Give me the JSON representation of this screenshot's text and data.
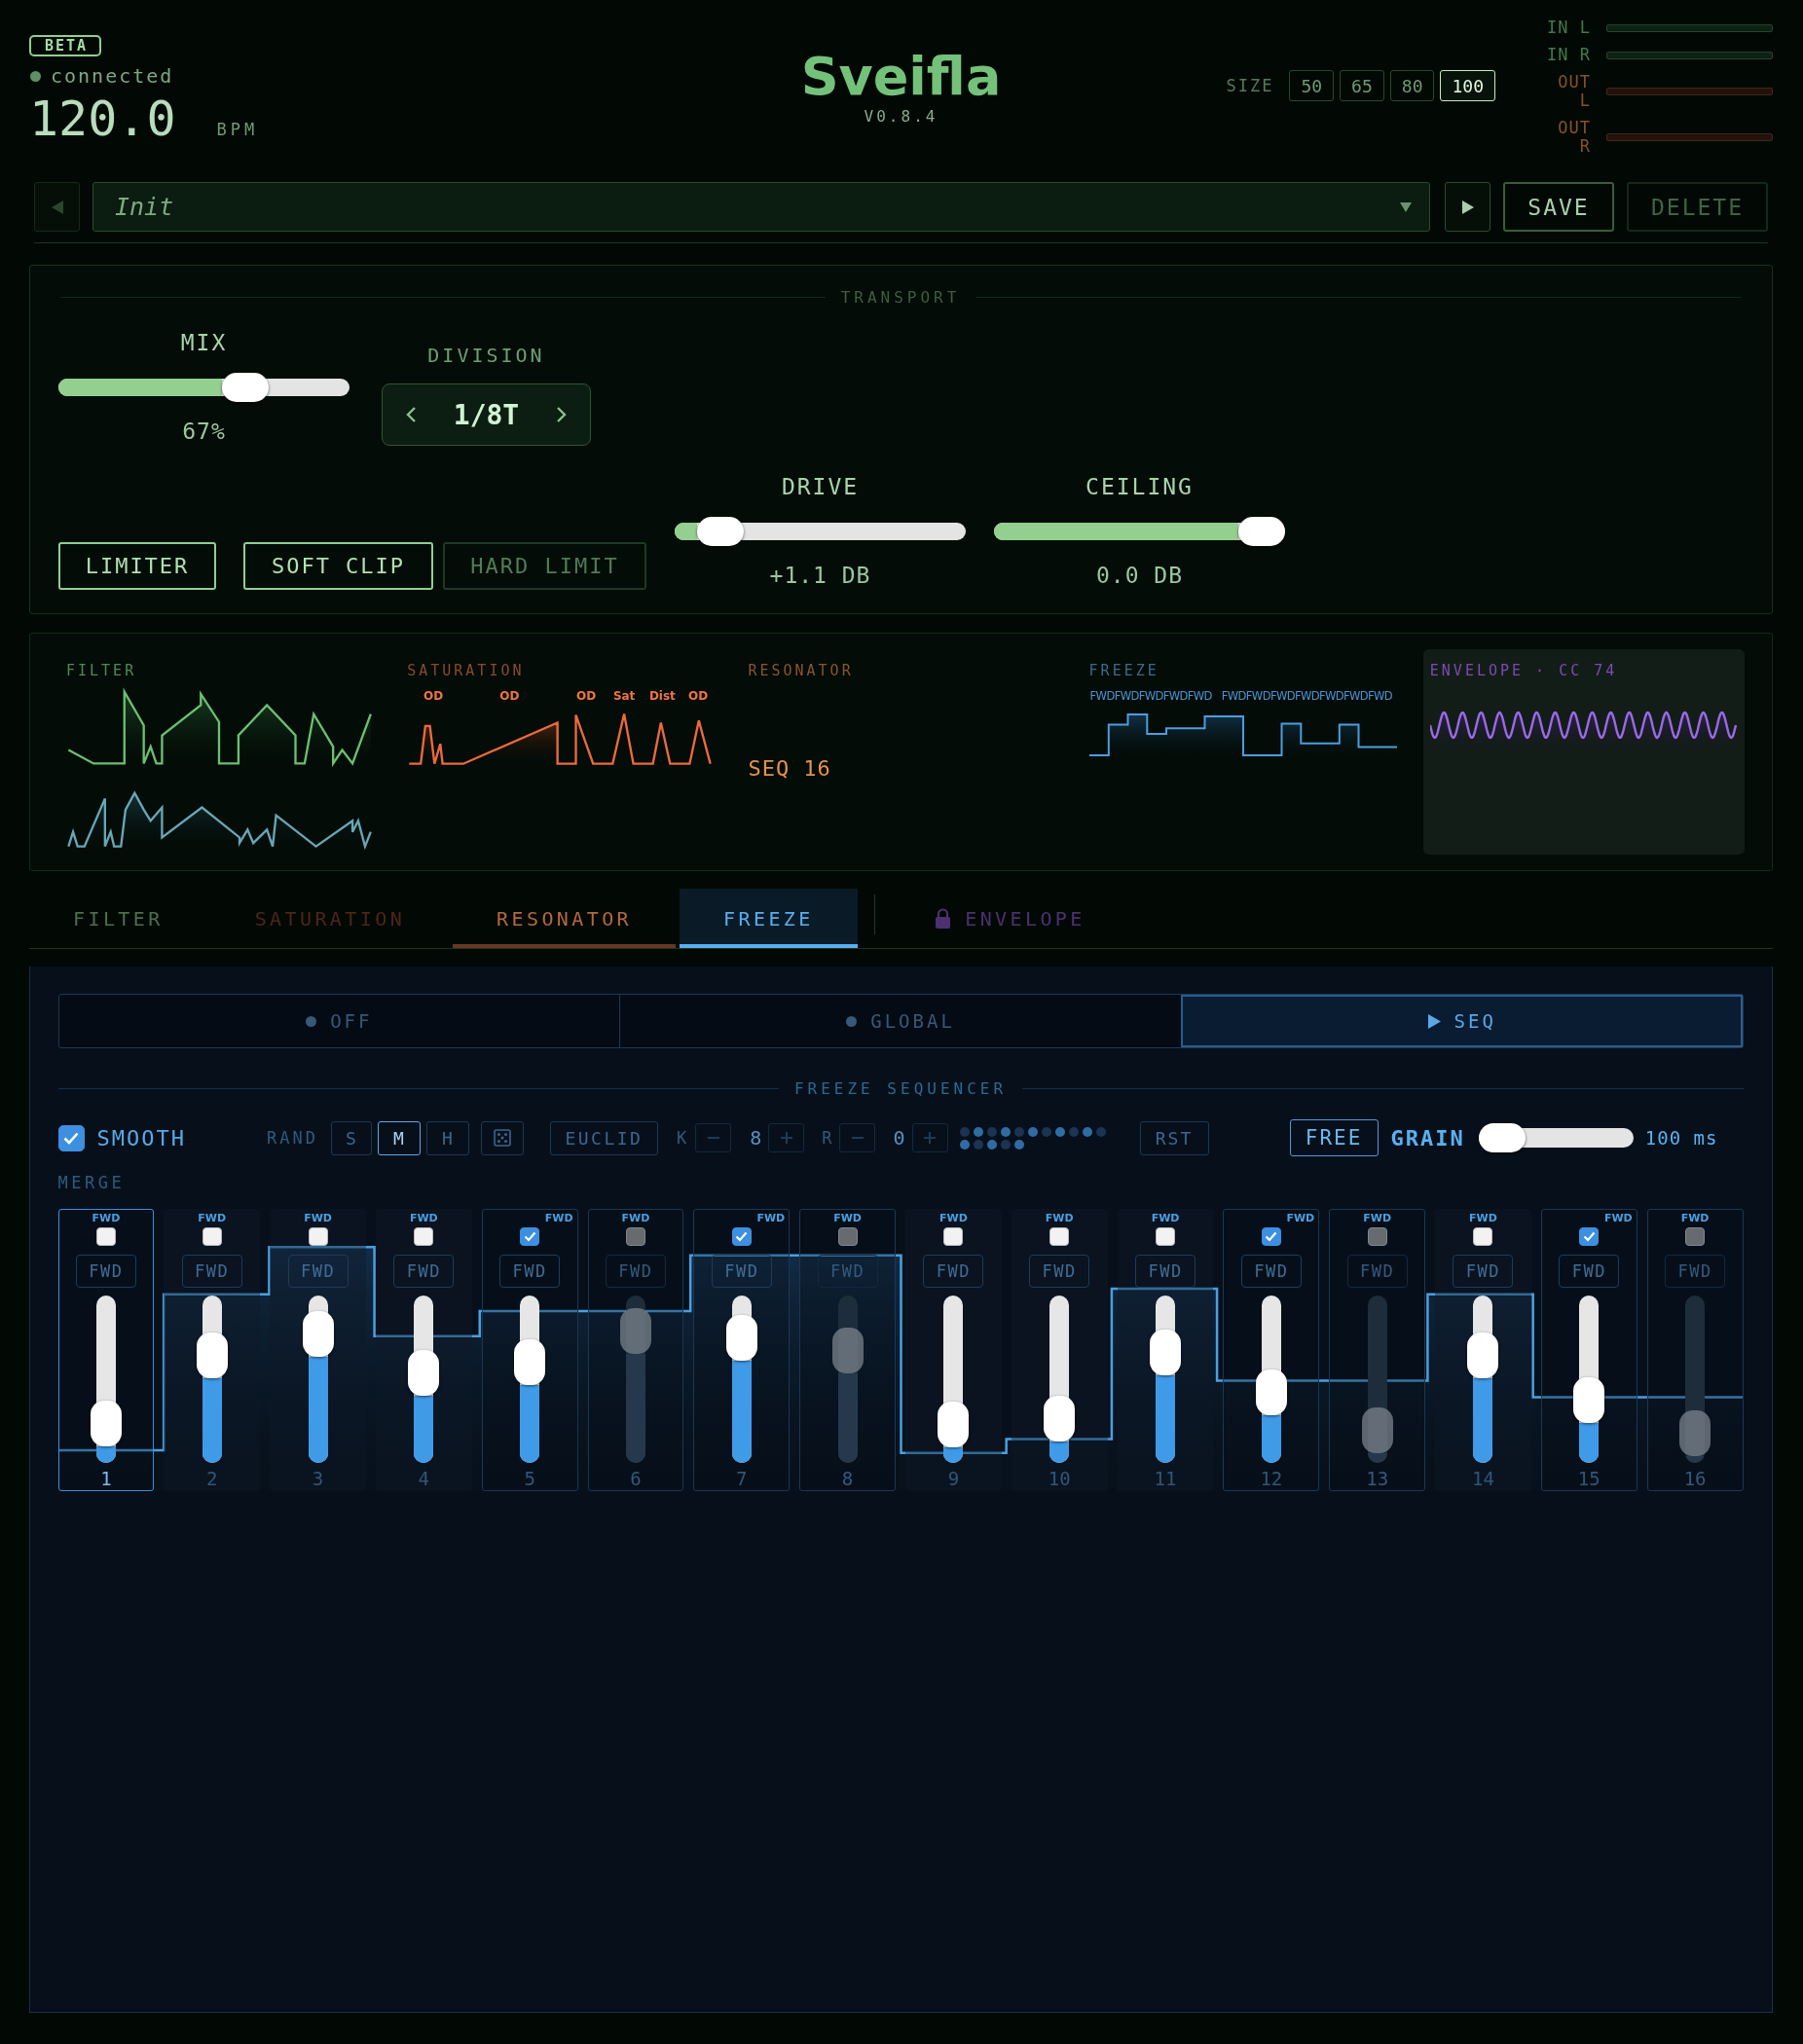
{
  "header": {
    "badge": "BETA",
    "status": {
      "label": "connected",
      "connected": true
    },
    "tempo": "120.0",
    "tempo_unit": "BPM",
    "title": "Sveifla",
    "version": "V0.8.4",
    "size": {
      "label": "SIZE",
      "options": [
        {
          "label": "50",
          "selected": false
        },
        {
          "label": "65",
          "selected": false
        },
        {
          "label": "80",
          "selected": false
        },
        {
          "label": "100",
          "selected": true
        }
      ]
    },
    "meters": [
      {
        "label": "IN L",
        "kind": "input",
        "level": 0
      },
      {
        "label": "IN R",
        "kind": "input",
        "level": 0
      },
      {
        "label": "OUT L",
        "kind": "output",
        "level": 0
      },
      {
        "label": "OUT R",
        "kind": "output",
        "level": 0
      }
    ]
  },
  "preset_bar": {
    "previous": {
      "disabled": true
    },
    "preset": {
      "value": "Init"
    },
    "next": {
      "disabled": false
    },
    "buttons": [
      {
        "label": "SAVE",
        "disabled": false
      },
      {
        "label": "DELETE",
        "disabled": true
      }
    ]
  },
  "transport": {
    "title": "TRANSPORT",
    "mix": {
      "label": "MIX",
      "level": 0.67,
      "reading": "67%"
    },
    "division": {
      "label": "DIVISION",
      "value": "1/8T"
    },
    "limiter": {
      "label": "LIMITER",
      "on": true
    },
    "clip_modes": [
      {
        "label": "SOFT CLIP",
        "selected": true
      },
      {
        "label": "HARD LIMIT",
        "selected": false
      }
    ],
    "drive": {
      "label": "DRIVE",
      "level": 0.09,
      "reading": "+1.1 DB"
    },
    "ceiling": {
      "label": "CEILING",
      "level": 1,
      "reading": "0.0 DB"
    }
  },
  "previews": [
    {
      "kind": "filter",
      "title": "FILTER",
      "color": "#4f8a5a",
      "highlighted": false
    },
    {
      "kind": "saturation",
      "title": "SATURATION",
      "color": "#8a4a2e",
      "highlighted": false,
      "markers": [
        "OD",
        "OD",
        "OD",
        "Sat",
        "Dist",
        "OD"
      ]
    },
    {
      "kind": "resonator",
      "title": "RESONATOR",
      "color": "#8a5530",
      "highlighted": false,
      "value": "SEQ 16"
    },
    {
      "kind": "freeze",
      "title": "FREEZE",
      "color": "#3f6a8c",
      "highlighted": false,
      "labels": [
        "FWDFWDFWDFWDFWD",
        "FWDFWDFWDFWDFWDFWDFWD"
      ]
    },
    {
      "kind": "envelope",
      "title": "ENVELOPE · CC 74",
      "color": "#7a4cb4",
      "highlighted": true
    }
  ],
  "tabs": [
    {
      "label": "FILTER",
      "color": "#4c6e50",
      "selected": false,
      "active": false,
      "locked": false
    },
    {
      "label": "SATURATION",
      "color": "#4e2519",
      "selected": false,
      "active": false,
      "locked": false
    },
    {
      "label": "RESONATOR",
      "color": "#b4683e",
      "selected": false,
      "active": true,
      "locked": false
    },
    {
      "label": "FREEZE",
      "color": "#58aef0",
      "selected": true,
      "active": true,
      "locked": false
    },
    {
      "label": "ENVELOPE",
      "color": "#4d3070",
      "selected": false,
      "active": false,
      "locked": true
    }
  ],
  "freeze": {
    "modes": [
      {
        "label": "OFF",
        "selected": false
      },
      {
        "label": "GLOBAL",
        "selected": false
      },
      {
        "label": "SEQ",
        "selected": true
      }
    ],
    "sequencer_title": "FREEZE SEQUENCER",
    "smooth": {
      "label": "SMOOTH",
      "checked": true
    },
    "rand": {
      "label": "RAND",
      "options": [
        {
          "label": "S",
          "selected": false
        },
        {
          "label": "M",
          "selected": true
        },
        {
          "label": "H",
          "selected": false
        }
      ]
    },
    "euclid": {
      "label": "EUCLID",
      "on": false,
      "k_label": "K",
      "k": "8",
      "r_label": "R",
      "r": "0",
      "pattern": [
        {
          "on": false
        },
        {
          "on": true
        },
        {
          "on": false
        },
        {
          "on": true
        },
        {
          "on": false
        },
        {
          "on": true
        },
        {
          "on": false
        },
        {
          "on": true
        },
        {
          "on": false
        },
        {
          "on": true
        },
        {
          "on": false
        },
        {
          "on": true
        },
        {
          "on": false
        },
        {
          "on": true
        },
        {
          "on": false
        },
        {
          "on": true
        }
      ]
    },
    "reset": {
      "label": "RST"
    },
    "free": {
      "label": "FREE",
      "on": true
    },
    "grain": {
      "label": "GRAIN",
      "level": 0,
      "reading": "100 ms"
    },
    "merge_label": "MERGE",
    "steps": [
      {
        "number": "1",
        "tag": "FWD",
        "direction": "FWD",
        "checked": false,
        "disabled": false,
        "current": true,
        "level": 0.14
      },
      {
        "number": "2",
        "tag": "FWD",
        "direction": "FWD",
        "checked": false,
        "disabled": false,
        "current": false,
        "level": 0.7
      },
      {
        "number": "3",
        "tag": "FWD",
        "direction": "FWD",
        "checked": false,
        "disabled": false,
        "current": false,
        "level": 0.87
      },
      {
        "number": "4",
        "tag": "FWD",
        "direction": "FWD",
        "checked": false,
        "disabled": false,
        "current": false,
        "level": 0.55
      },
      {
        "number": "5",
        "tag": "FWD",
        "direction": "FWD",
        "checked": true,
        "disabled": false,
        "current": false,
        "level": 0.64
      },
      {
        "number": "6",
        "tag": "FWD",
        "direction": "FWD",
        "checked": false,
        "disabled": true,
        "current": false,
        "level": 0.9
      },
      {
        "number": "7",
        "tag": "FWD",
        "direction": "FWD",
        "checked": true,
        "disabled": false,
        "current": false,
        "level": 0.84
      },
      {
        "number": "8",
        "tag": "FWD",
        "direction": "FWD",
        "checked": false,
        "disabled": true,
        "current": false,
        "level": 0.74
      },
      {
        "number": "9",
        "tag": "FWD",
        "direction": "FWD",
        "checked": false,
        "disabled": false,
        "current": false,
        "level": 0.13
      },
      {
        "number": "10",
        "tag": "FWD",
        "direction": "FWD",
        "checked": false,
        "disabled": false,
        "current": false,
        "level": 0.18
      },
      {
        "number": "11",
        "tag": "FWD",
        "direction": "FWD",
        "checked": false,
        "disabled": false,
        "current": false,
        "level": 0.72
      },
      {
        "number": "12",
        "tag": "FWD",
        "direction": "FWD",
        "checked": true,
        "disabled": false,
        "current": false,
        "level": 0.39
      },
      {
        "number": "13",
        "tag": "FWD",
        "direction": "FWD",
        "checked": false,
        "disabled": true,
        "current": false,
        "level": 0.08
      },
      {
        "number": "14",
        "tag": "FWD",
        "direction": "FWD",
        "checked": false,
        "disabled": false,
        "current": false,
        "level": 0.7
      },
      {
        "number": "15",
        "tag": "FWD",
        "direction": "FWD",
        "checked": true,
        "disabled": false,
        "current": false,
        "level": 0.33
      },
      {
        "number": "16",
        "tag": "FWD",
        "direction": "FWD",
        "checked": false,
        "disabled": true,
        "current": false,
        "level": 0.06
      }
    ]
  }
}
